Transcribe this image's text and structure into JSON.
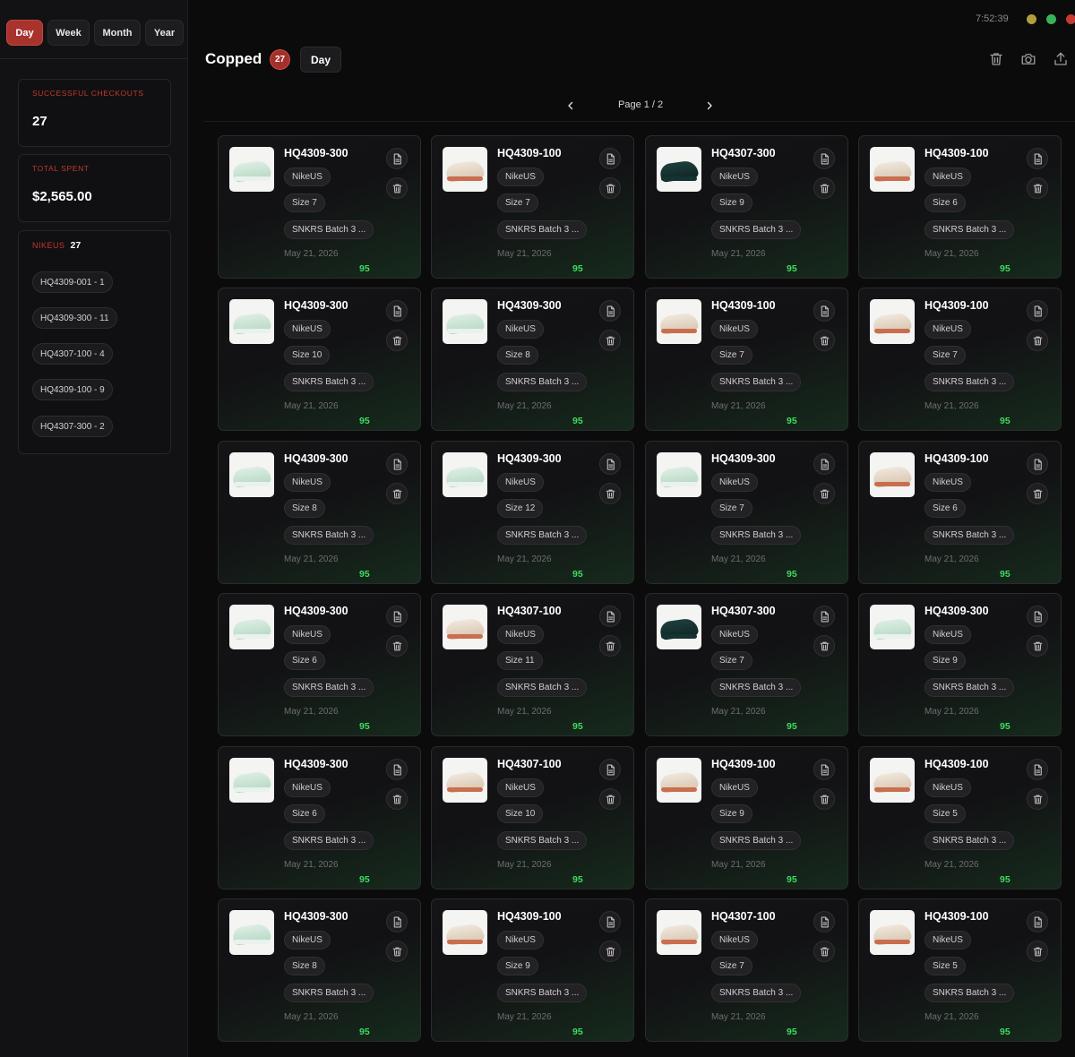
{
  "sidebar": {
    "tabs": [
      "Day",
      "Week",
      "Month",
      "Year"
    ],
    "active_tab": "Day",
    "checkouts_label": "SUCCESSFUL CHECKOUTS",
    "checkouts_value": "27",
    "spent_label": "TOTAL SPENT",
    "spent_value": "$2,565.00",
    "site_name": "NIKEUS",
    "site_count": "27",
    "sku_breakdown": [
      "HQ4309-001 - 1",
      "HQ4309-300 - 11",
      "HQ4307-100 - 4",
      "HQ4309-100 - 9",
      "HQ4307-300 - 2"
    ]
  },
  "header": {
    "clock": "7:52:39",
    "title": "Copped",
    "count": "27",
    "range": "Day",
    "icons": [
      "trash-icon",
      "camera-icon",
      "upload-icon"
    ]
  },
  "pagination": {
    "label": "Page 1 / 2"
  },
  "colors": {
    "accent": "#a8322c",
    "score": "#3ddc5f",
    "background": "#0b0b0c"
  },
  "cards": [
    {
      "sku": "HQ4309-300",
      "site": "NikeUS",
      "size": "Size 7",
      "batch": "SNKRS Batch 3 ...",
      "date": "May 21, 2026",
      "score": "95",
      "color": "mint"
    },
    {
      "sku": "HQ4309-100",
      "site": "NikeUS",
      "size": "Size 7",
      "batch": "SNKRS Batch 3 ...",
      "date": "May 21, 2026",
      "score": "95",
      "color": "cream"
    },
    {
      "sku": "HQ4307-300",
      "site": "NikeUS",
      "size": "Size 9",
      "batch": "SNKRS Batch 3 ...",
      "date": "May 21, 2026",
      "score": "95",
      "color": "dark"
    },
    {
      "sku": "HQ4309-100",
      "site": "NikeUS",
      "size": "Size 6",
      "batch": "SNKRS Batch 3 ...",
      "date": "May 21, 2026",
      "score": "95",
      "color": "cream"
    },
    {
      "sku": "HQ4309-300",
      "site": "NikeUS",
      "size": "Size 10",
      "batch": "SNKRS Batch 3 ...",
      "date": "May 21, 2026",
      "score": "95",
      "color": "mint"
    },
    {
      "sku": "HQ4309-300",
      "site": "NikeUS",
      "size": "Size 8",
      "batch": "SNKRS Batch 3 ...",
      "date": "May 21, 2026",
      "score": "95",
      "color": "mint"
    },
    {
      "sku": "HQ4309-100",
      "site": "NikeUS",
      "size": "Size 7",
      "batch": "SNKRS Batch 3 ...",
      "date": "May 21, 2026",
      "score": "95",
      "color": "cream"
    },
    {
      "sku": "HQ4309-100",
      "site": "NikeUS",
      "size": "Size 7",
      "batch": "SNKRS Batch 3 ...",
      "date": "May 21, 2026",
      "score": "95",
      "color": "cream"
    },
    {
      "sku": "HQ4309-300",
      "site": "NikeUS",
      "size": "Size 8",
      "batch": "SNKRS Batch 3 ...",
      "date": "May 21, 2026",
      "score": "95",
      "color": "mint"
    },
    {
      "sku": "HQ4309-300",
      "site": "NikeUS",
      "size": "Size 12",
      "batch": "SNKRS Batch 3 ...",
      "date": "May 21, 2026",
      "score": "95",
      "color": "mint"
    },
    {
      "sku": "HQ4309-300",
      "site": "NikeUS",
      "size": "Size 7",
      "batch": "SNKRS Batch 3 ...",
      "date": "May 21, 2026",
      "score": "95",
      "color": "mint"
    },
    {
      "sku": "HQ4309-100",
      "site": "NikeUS",
      "size": "Size 6",
      "batch": "SNKRS Batch 3 ...",
      "date": "May 21, 2026",
      "score": "95",
      "color": "cream"
    },
    {
      "sku": "HQ4309-300",
      "site": "NikeUS",
      "size": "Size 6",
      "batch": "SNKRS Batch 3 ...",
      "date": "May 21, 2026",
      "score": "95",
      "color": "mint"
    },
    {
      "sku": "HQ4307-100",
      "site": "NikeUS",
      "size": "Size 11",
      "batch": "SNKRS Batch 3 ...",
      "date": "May 21, 2026",
      "score": "95",
      "color": "cream"
    },
    {
      "sku": "HQ4307-300",
      "site": "NikeUS",
      "size": "Size 7",
      "batch": "SNKRS Batch 3 ...",
      "date": "May 21, 2026",
      "score": "95",
      "color": "dark"
    },
    {
      "sku": "HQ4309-300",
      "site": "NikeUS",
      "size": "Size 9",
      "batch": "SNKRS Batch 3 ...",
      "date": "May 21, 2026",
      "score": "95",
      "color": "mint"
    },
    {
      "sku": "HQ4309-300",
      "site": "NikeUS",
      "size": "Size 6",
      "batch": "SNKRS Batch 3 ...",
      "date": "May 21, 2026",
      "score": "95",
      "color": "mint"
    },
    {
      "sku": "HQ4307-100",
      "site": "NikeUS",
      "size": "Size 10",
      "batch": "SNKRS Batch 3 ...",
      "date": "May 21, 2026",
      "score": "95",
      "color": "cream"
    },
    {
      "sku": "HQ4309-100",
      "site": "NikeUS",
      "size": "Size 9",
      "batch": "SNKRS Batch 3 ...",
      "date": "May 21, 2026",
      "score": "95",
      "color": "cream"
    },
    {
      "sku": "HQ4309-100",
      "site": "NikeUS",
      "size": "Size 5",
      "batch": "SNKRS Batch 3 ...",
      "date": "May 21, 2026",
      "score": "95",
      "color": "cream"
    },
    {
      "sku": "HQ4309-300",
      "site": "NikeUS",
      "size": "Size 8",
      "batch": "SNKRS Batch 3 ...",
      "date": "May 21, 2026",
      "score": "95",
      "color": "mint"
    },
    {
      "sku": "HQ4309-100",
      "site": "NikeUS",
      "size": "Size 9",
      "batch": "SNKRS Batch 3 ...",
      "date": "May 21, 2026",
      "score": "95",
      "color": "cream"
    },
    {
      "sku": "HQ4307-100",
      "site": "NikeUS",
      "size": "Size 7",
      "batch": "SNKRS Batch 3 ...",
      "date": "May 21, 2026",
      "score": "95",
      "color": "cream"
    },
    {
      "sku": "HQ4309-100",
      "site": "NikeUS",
      "size": "Size 5",
      "batch": "SNKRS Batch 3 ...",
      "date": "May 21, 2026",
      "score": "95",
      "color": "cream"
    }
  ]
}
